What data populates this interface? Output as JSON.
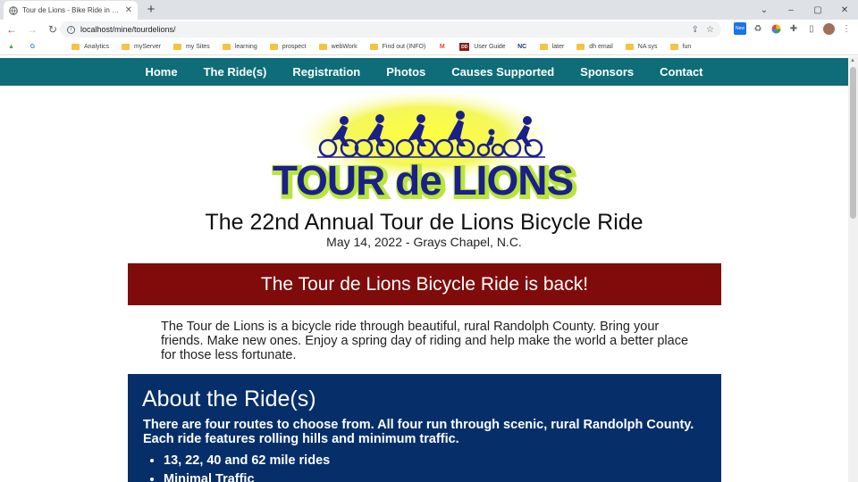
{
  "browser": {
    "tab_title": "Tour de Lions - Bike Ride in Randolph County",
    "url": "localhost/mine/tourdelions/",
    "new_tab": "+",
    "window_controls": [
      "⌄",
      "–",
      "▢",
      "✕"
    ]
  },
  "bookmarks": [
    {
      "label": "",
      "icon": "google-drive-icon"
    },
    {
      "label": "",
      "icon": "google-icon"
    },
    {
      "label": "",
      "icon": "apple-icon"
    },
    {
      "label": "Analytics",
      "icon": "folder-icon"
    },
    {
      "label": "myServer",
      "icon": "folder-icon"
    },
    {
      "label": "my Sites",
      "icon": "folder-icon"
    },
    {
      "label": "learning",
      "icon": "folder-icon"
    },
    {
      "label": "prospect",
      "icon": "folder-icon"
    },
    {
      "label": "webWork",
      "icon": "folder-icon"
    },
    {
      "label": "Find out (INFO)",
      "icon": "folder-icon"
    },
    {
      "label": "",
      "icon": "gmail-icon"
    },
    {
      "label": "User Guide",
      "icon": "dd-icon"
    },
    {
      "label": "",
      "icon": "nc-icon"
    },
    {
      "label": "later",
      "icon": "folder-icon"
    },
    {
      "label": "dh email",
      "icon": "folder-icon"
    },
    {
      "label": "NA sys",
      "icon": "folder-icon"
    },
    {
      "label": "fun",
      "icon": "folder-icon"
    }
  ],
  "site": {
    "nav": [
      "Home",
      "The Ride(s)",
      "Registration",
      "Photos",
      "Causes Supported",
      "Sponsors",
      "Contact"
    ],
    "logo_text": "TOUR de LIONS",
    "headline": "The 22nd Annual Tour de Lions Bicycle Ride",
    "subhead": "May 14, 2022 - Grays Chapel, N.C.",
    "banner": "The Tour de Lions Bicycle Ride is back!",
    "intro": "The Tour de Lions is a bicycle ride through beautiful, rural Randolph County. Bring your friends. Make new ones. Enjoy a spring day of riding and help make the world a better place for those less fortunate.",
    "about": {
      "title": "About the Ride(s)",
      "text": "There are four routes to choose from. All four run through scenic, rural Randolph County. Each ride features rolling hills and minimum traffic.",
      "items": [
        "13, 22, 40 and 62 mile rides",
        "Minimal Traffic"
      ]
    }
  },
  "colors": {
    "nav_bg": "#0e6d78",
    "banner_bg": "#7f0c0b",
    "about_bg": "#062f6a",
    "logo_text": "#1b1f8a",
    "logo_outline": "#b8e637"
  }
}
